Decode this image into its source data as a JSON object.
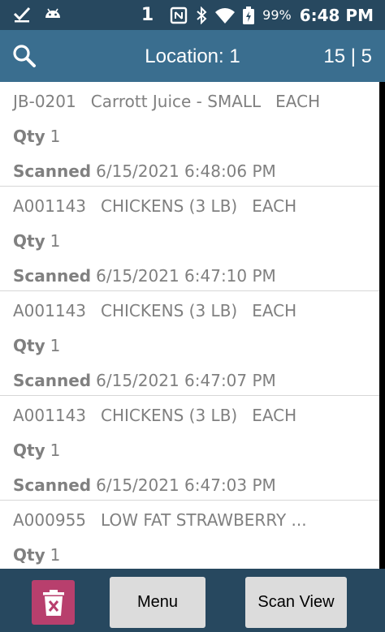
{
  "status_bar": {
    "notification_count": "1",
    "battery_percent": "99%",
    "time": "6:48 PM",
    "icons": [
      "check-download-icon",
      "android-icon",
      "nfc-icon",
      "bluetooth-icon",
      "wifi-icon",
      "battery-icon"
    ]
  },
  "header": {
    "title": "Location: 1",
    "count": "15 | 5",
    "search_icon": "search-icon"
  },
  "items": [
    {
      "code": "JB-0201",
      "name": "Carrott Juice - SMALL",
      "unit": "EACH",
      "qty_label": "Qty",
      "qty": "1",
      "scanned_label": "Scanned",
      "scanned": "6/15/2021 6:48:06 PM"
    },
    {
      "code": "A001143",
      "name": "CHICKENS (3 LB)",
      "unit": "EACH",
      "qty_label": "Qty",
      "qty": "1",
      "scanned_label": "Scanned",
      "scanned": "6/15/2021 6:47:10 PM"
    },
    {
      "code": "A001143",
      "name": "CHICKENS (3 LB)",
      "unit": "EACH",
      "qty_label": "Qty",
      "qty": "1",
      "scanned_label": "Scanned",
      "scanned": "6/15/2021 6:47:07 PM"
    },
    {
      "code": "A001143",
      "name": "CHICKENS (3 LB)",
      "unit": "EACH",
      "qty_label": "Qty",
      "qty": "1",
      "scanned_label": "Scanned",
      "scanned": "6/15/2021 6:47:03 PM"
    },
    {
      "code": "A000955",
      "name": "LOW FAT STRAWBERRY ...",
      "unit": "",
      "qty_label": "Qty",
      "qty": "1",
      "scanned_label": "",
      "scanned": ""
    }
  ],
  "footer": {
    "delete_icon": "trash-icon",
    "menu_label": "Menu",
    "scan_view_label": "Scan View"
  },
  "colors": {
    "status_bar": "#27485f",
    "app_bar": "#3a6e8f",
    "delete_button": "#b83f6d",
    "button": "#dcdcdc",
    "item_text": "#808080"
  }
}
